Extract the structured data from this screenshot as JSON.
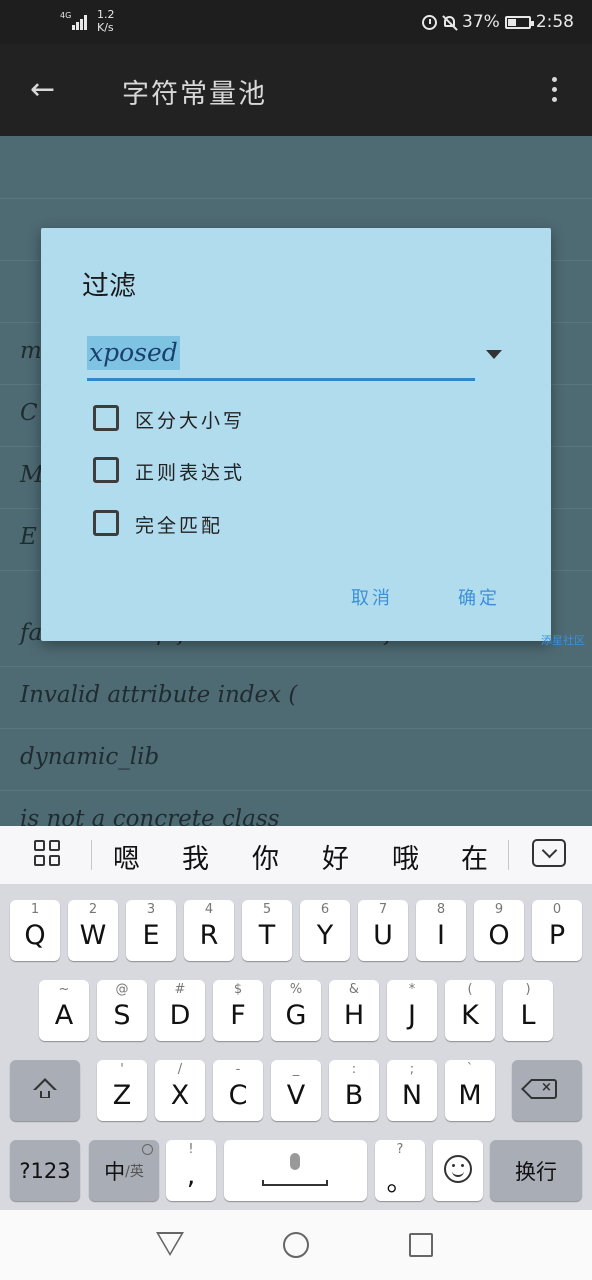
{
  "status_bar": {
    "network": "4G",
    "speed_value": "1.2",
    "speed_unit": "K/s",
    "battery": "37%",
    "time": "2:58",
    "icons": [
      "signal-icon",
      "alarm-icon",
      "mute-icon",
      "battery-icon"
    ]
  },
  "toolbar": {
    "title": "字符常量池",
    "back_icon": "arrow-left-icon",
    "menu_icon": "more-vert-icon"
  },
  "list": {
    "rows": [
      {
        "text": "m"
      },
      {
        "text": "C"
      },
      {
        "text": "M"
      },
      {
        "text": "E"
      },
      {
        "text": "failed to skip file name in local file header"
      },
      {
        "text": "Invalid attribute index ("
      },
      {
        "text": "dynamic_lib"
      },
      {
        "text": " is not a concrete class"
      }
    ]
  },
  "dialog": {
    "title": "过滤",
    "input_value": "xposed",
    "options": [
      {
        "label": "区分大小写",
        "checked": false
      },
      {
        "label": "正则表达式",
        "checked": false
      },
      {
        "label": "完全匹配",
        "checked": false
      }
    ],
    "cancel_label": "取消",
    "ok_label": "确定",
    "accent_color": "#2f86c9"
  },
  "watermark": "添星社区",
  "suggestions": {
    "words": [
      "嗯",
      "我",
      "你",
      "好",
      "哦",
      "在"
    ]
  },
  "keyboard": {
    "row1": [
      {
        "sub": "1",
        "main": "Q"
      },
      {
        "sub": "2",
        "main": "W"
      },
      {
        "sub": "3",
        "main": "E"
      },
      {
        "sub": "4",
        "main": "R"
      },
      {
        "sub": "5",
        "main": "T"
      },
      {
        "sub": "6",
        "main": "Y"
      },
      {
        "sub": "7",
        "main": "U"
      },
      {
        "sub": "8",
        "main": "I"
      },
      {
        "sub": "9",
        "main": "O"
      },
      {
        "sub": "0",
        "main": "P"
      }
    ],
    "row2": [
      {
        "sub": "~",
        "main": "A"
      },
      {
        "sub": "@",
        "main": "S"
      },
      {
        "sub": "#",
        "main": "D"
      },
      {
        "sub": "$",
        "main": "F"
      },
      {
        "sub": "%",
        "main": "G"
      },
      {
        "sub": "&",
        "main": "H"
      },
      {
        "sub": "*",
        "main": "J"
      },
      {
        "sub": "(",
        "main": "K"
      },
      {
        "sub": ")",
        "main": "L"
      }
    ],
    "row3": [
      {
        "sub": "'",
        "main": "Z"
      },
      {
        "sub": "/",
        "main": "X"
      },
      {
        "sub": "-",
        "main": "C"
      },
      {
        "sub": "_",
        "main": "V"
      },
      {
        "sub": ":",
        "main": "B"
      },
      {
        "sub": ";",
        "main": "N"
      },
      {
        "sub": "`",
        "main": "M"
      }
    ],
    "num_label": "?123",
    "lang_main": "中",
    "lang_sub": "/英",
    "comma_sub": "!",
    "comma_main": ",",
    "period_sub": "?",
    "period_main": "。",
    "enter_label": "换行"
  }
}
